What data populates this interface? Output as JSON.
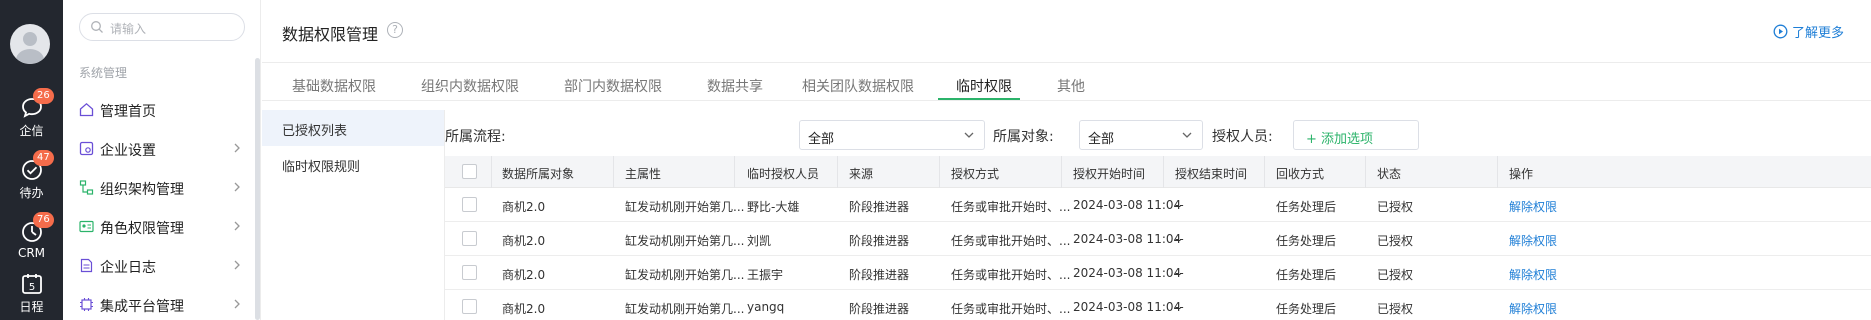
{
  "rail": {
    "items": [
      {
        "label": "企信",
        "badge": "26",
        "icon": "chat-bubble-icon"
      },
      {
        "label": "待办",
        "badge": "47",
        "icon": "check-circle-icon"
      },
      {
        "label": "CRM",
        "badge": "76",
        "icon": "crm-gauge-icon"
      },
      {
        "label": "日程",
        "badge": "",
        "icon": "calendar-icon",
        "day": "5"
      }
    ]
  },
  "nav": {
    "search_placeholder": "请输入",
    "section": "系统管理",
    "items": [
      {
        "label": "管理首页",
        "icon": "home-icon"
      },
      {
        "label": "企业设置",
        "icon": "company-settings-icon"
      },
      {
        "label": "组织架构管理",
        "icon": "org-tree-icon"
      },
      {
        "label": "角色权限管理",
        "icon": "role-card-icon"
      },
      {
        "label": "企业日志",
        "icon": "log-document-icon"
      },
      {
        "label": "集成平台管理",
        "icon": "integration-icon"
      }
    ]
  },
  "header": {
    "title": "数据权限管理",
    "help_glyph": "?",
    "learn_more": "了解更多"
  },
  "tabs": [
    "基础数据权限",
    "组织内数据权限",
    "部门内数据权限",
    "数据共享",
    "相关团队数据权限",
    "临时权限",
    "其他"
  ],
  "active_tab": "临时权限",
  "subnav": [
    "已授权列表",
    "临时权限规则"
  ],
  "filters": {
    "process_label": "所属流程:",
    "process_value": "全部",
    "object_label": "所属对象:",
    "object_value": "全部",
    "grantee_label": "授权人员:",
    "add_option": "+ 添加选项"
  },
  "table": {
    "columns": [
      "数据所属对象",
      "主属性",
      "临时授权人员",
      "来源",
      "授权方式",
      "授权开始时间",
      "授权结束时间",
      "回收方式",
      "状态",
      "操作"
    ],
    "rows": [
      [
        "商机2.0",
        "缸发动机刚开始第几...",
        "野比-大雄",
        "阶段推进器",
        "任务或审批开始时、...",
        "2024-03-08 11:04",
        "--",
        "任务处理后",
        "已授权",
        "解除权限"
      ],
      [
        "商机2.0",
        "缸发动机刚开始第几...",
        "刘凯",
        "阶段推进器",
        "任务或审批开始时、...",
        "2024-03-08 11:04",
        "--",
        "任务处理后",
        "已授权",
        "解除权限"
      ],
      [
        "商机2.0",
        "缸发动机刚开始第几...",
        "王振宇",
        "阶段推进器",
        "任务或审批开始时、...",
        "2024-03-08 11:04",
        "--",
        "任务处理后",
        "已授权",
        "解除权限"
      ],
      [
        "商机2.0",
        "缸发动机刚开始第几...",
        "yangq",
        "阶段推进器",
        "任务或审批开始时、...",
        "2024-03-08 11:04",
        "--",
        "任务处理后",
        "已授权",
        "解除权限"
      ]
    ]
  },
  "colors": {
    "accent_green": "#2bb36a",
    "link_blue": "#1e7ed6",
    "badge_red": "#f56c4b",
    "rail_bg": "#23272f"
  }
}
